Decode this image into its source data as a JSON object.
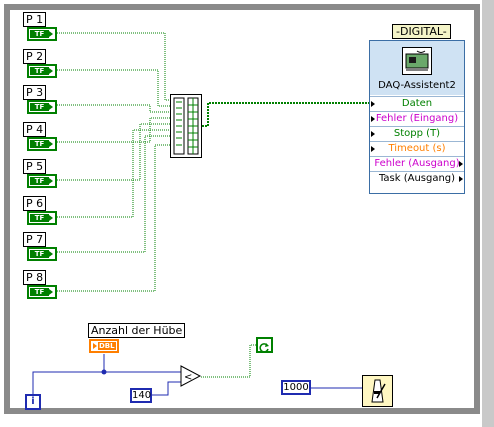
{
  "controls": [
    {
      "name": "P 1",
      "type": "TF"
    },
    {
      "name": "P 2",
      "type": "TF"
    },
    {
      "name": "P 3",
      "type": "TF"
    },
    {
      "name": "P 4",
      "type": "TF"
    },
    {
      "name": "P 5",
      "type": "TF"
    },
    {
      "name": "P 6",
      "type": "TF"
    },
    {
      "name": "P 7",
      "type": "TF"
    },
    {
      "name": "P 8",
      "type": "TF"
    }
  ],
  "daq": {
    "title": "-DIGITAL-",
    "name": "DAQ-Assistent2",
    "terminals": [
      {
        "label": "Daten",
        "color": "#008000"
      },
      {
        "label": "Fehler (Eingang)",
        "color": "#cc00cc"
      },
      {
        "label": "Stopp (T)",
        "color": "#008000"
      },
      {
        "label": "Timeout (s)",
        "color": "#ff7f00"
      },
      {
        "label": "Fehler (Ausgang)",
        "color": "#cc00cc"
      },
      {
        "label": "Task (Ausgang)",
        "color": "#000000"
      }
    ]
  },
  "hub": {
    "label": "Anzahl der Hübe",
    "type": "DBL"
  },
  "constants": {
    "limit": "140",
    "wait_ms": "1000"
  },
  "iteration": "i",
  "colors": {
    "boolean_wire": "#008000",
    "numeric_wire": "#1f2bb0",
    "dbl": "#ff7f00",
    "error": "#cc00cc",
    "daq_head": "#cfe2f3"
  }
}
